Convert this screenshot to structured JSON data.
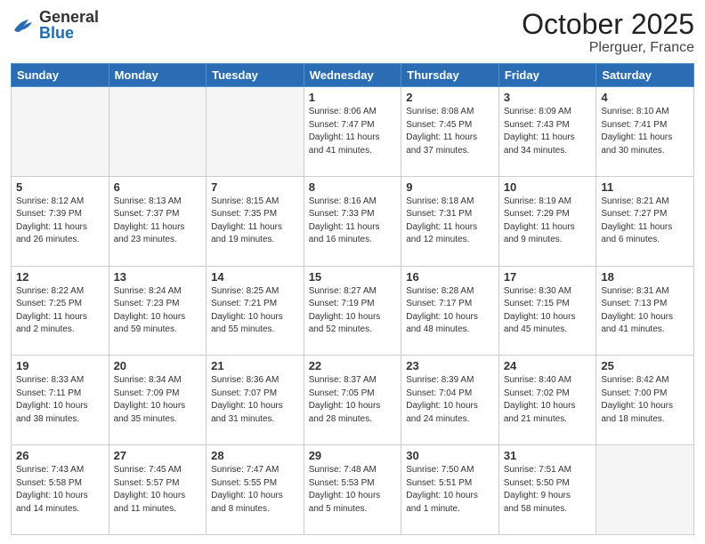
{
  "header": {
    "logo_general": "General",
    "logo_blue": "Blue",
    "month_title": "October 2025",
    "location": "Plerguer, France"
  },
  "weekdays": [
    "Sunday",
    "Monday",
    "Tuesday",
    "Wednesday",
    "Thursday",
    "Friday",
    "Saturday"
  ],
  "weeks": [
    [
      {
        "day": "",
        "info": ""
      },
      {
        "day": "",
        "info": ""
      },
      {
        "day": "",
        "info": ""
      },
      {
        "day": "1",
        "info": "Sunrise: 8:06 AM\nSunset: 7:47 PM\nDaylight: 11 hours\nand 41 minutes."
      },
      {
        "day": "2",
        "info": "Sunrise: 8:08 AM\nSunset: 7:45 PM\nDaylight: 11 hours\nand 37 minutes."
      },
      {
        "day": "3",
        "info": "Sunrise: 8:09 AM\nSunset: 7:43 PM\nDaylight: 11 hours\nand 34 minutes."
      },
      {
        "day": "4",
        "info": "Sunrise: 8:10 AM\nSunset: 7:41 PM\nDaylight: 11 hours\nand 30 minutes."
      }
    ],
    [
      {
        "day": "5",
        "info": "Sunrise: 8:12 AM\nSunset: 7:39 PM\nDaylight: 11 hours\nand 26 minutes."
      },
      {
        "day": "6",
        "info": "Sunrise: 8:13 AM\nSunset: 7:37 PM\nDaylight: 11 hours\nand 23 minutes."
      },
      {
        "day": "7",
        "info": "Sunrise: 8:15 AM\nSunset: 7:35 PM\nDaylight: 11 hours\nand 19 minutes."
      },
      {
        "day": "8",
        "info": "Sunrise: 8:16 AM\nSunset: 7:33 PM\nDaylight: 11 hours\nand 16 minutes."
      },
      {
        "day": "9",
        "info": "Sunrise: 8:18 AM\nSunset: 7:31 PM\nDaylight: 11 hours\nand 12 minutes."
      },
      {
        "day": "10",
        "info": "Sunrise: 8:19 AM\nSunset: 7:29 PM\nDaylight: 11 hours\nand 9 minutes."
      },
      {
        "day": "11",
        "info": "Sunrise: 8:21 AM\nSunset: 7:27 PM\nDaylight: 11 hours\nand 6 minutes."
      }
    ],
    [
      {
        "day": "12",
        "info": "Sunrise: 8:22 AM\nSunset: 7:25 PM\nDaylight: 11 hours\nand 2 minutes."
      },
      {
        "day": "13",
        "info": "Sunrise: 8:24 AM\nSunset: 7:23 PM\nDaylight: 10 hours\nand 59 minutes."
      },
      {
        "day": "14",
        "info": "Sunrise: 8:25 AM\nSunset: 7:21 PM\nDaylight: 10 hours\nand 55 minutes."
      },
      {
        "day": "15",
        "info": "Sunrise: 8:27 AM\nSunset: 7:19 PM\nDaylight: 10 hours\nand 52 minutes."
      },
      {
        "day": "16",
        "info": "Sunrise: 8:28 AM\nSunset: 7:17 PM\nDaylight: 10 hours\nand 48 minutes."
      },
      {
        "day": "17",
        "info": "Sunrise: 8:30 AM\nSunset: 7:15 PM\nDaylight: 10 hours\nand 45 minutes."
      },
      {
        "day": "18",
        "info": "Sunrise: 8:31 AM\nSunset: 7:13 PM\nDaylight: 10 hours\nand 41 minutes."
      }
    ],
    [
      {
        "day": "19",
        "info": "Sunrise: 8:33 AM\nSunset: 7:11 PM\nDaylight: 10 hours\nand 38 minutes."
      },
      {
        "day": "20",
        "info": "Sunrise: 8:34 AM\nSunset: 7:09 PM\nDaylight: 10 hours\nand 35 minutes."
      },
      {
        "day": "21",
        "info": "Sunrise: 8:36 AM\nSunset: 7:07 PM\nDaylight: 10 hours\nand 31 minutes."
      },
      {
        "day": "22",
        "info": "Sunrise: 8:37 AM\nSunset: 7:05 PM\nDaylight: 10 hours\nand 28 minutes."
      },
      {
        "day": "23",
        "info": "Sunrise: 8:39 AM\nSunset: 7:04 PM\nDaylight: 10 hours\nand 24 minutes."
      },
      {
        "day": "24",
        "info": "Sunrise: 8:40 AM\nSunset: 7:02 PM\nDaylight: 10 hours\nand 21 minutes."
      },
      {
        "day": "25",
        "info": "Sunrise: 8:42 AM\nSunset: 7:00 PM\nDaylight: 10 hours\nand 18 minutes."
      }
    ],
    [
      {
        "day": "26",
        "info": "Sunrise: 7:43 AM\nSunset: 5:58 PM\nDaylight: 10 hours\nand 14 minutes."
      },
      {
        "day": "27",
        "info": "Sunrise: 7:45 AM\nSunset: 5:57 PM\nDaylight: 10 hours\nand 11 minutes."
      },
      {
        "day": "28",
        "info": "Sunrise: 7:47 AM\nSunset: 5:55 PM\nDaylight: 10 hours\nand 8 minutes."
      },
      {
        "day": "29",
        "info": "Sunrise: 7:48 AM\nSunset: 5:53 PM\nDaylight: 10 hours\nand 5 minutes."
      },
      {
        "day": "30",
        "info": "Sunrise: 7:50 AM\nSunset: 5:51 PM\nDaylight: 10 hours\nand 1 minute."
      },
      {
        "day": "31",
        "info": "Sunrise: 7:51 AM\nSunset: 5:50 PM\nDaylight: 9 hours\nand 58 minutes."
      },
      {
        "day": "",
        "info": ""
      }
    ]
  ]
}
